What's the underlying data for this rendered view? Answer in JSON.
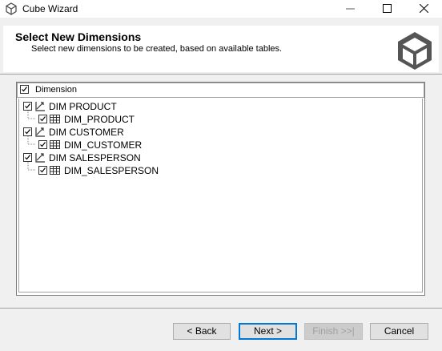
{
  "window": {
    "title": "Cube Wizard",
    "controls": [
      "minimize-icon",
      "maximize-icon",
      "close-icon"
    ]
  },
  "header": {
    "title": "Select New Dimensions",
    "subtitle": "Select new dimensions to be created, based on available tables.",
    "logo_icon": "cube-icon"
  },
  "tree": {
    "column_header": "Dimension",
    "header_checked": true,
    "dimensions": [
      {
        "label": "DIM PRODUCT",
        "checked": true,
        "icon": "dimension-icon",
        "table": {
          "label": "DIM_PRODUCT",
          "checked": true,
          "icon": "table-icon"
        }
      },
      {
        "label": "DIM CUSTOMER",
        "checked": true,
        "icon": "dimension-icon",
        "table": {
          "label": "DIM_CUSTOMER",
          "checked": true,
          "icon": "table-icon"
        }
      },
      {
        "label": "DIM SALESPERSON",
        "checked": true,
        "icon": "dimension-icon",
        "table": {
          "label": "DIM_SALESPERSON",
          "checked": true,
          "icon": "table-icon"
        }
      }
    ]
  },
  "footer": {
    "back_label": "< Back",
    "next_label": "Next >",
    "finish_label": "Finish >>|",
    "cancel_label": "Cancel",
    "finish_enabled": false
  },
  "colors": {
    "accent": "#0078d7",
    "window_bg": "#f0f0f0",
    "logo": "#555555"
  }
}
